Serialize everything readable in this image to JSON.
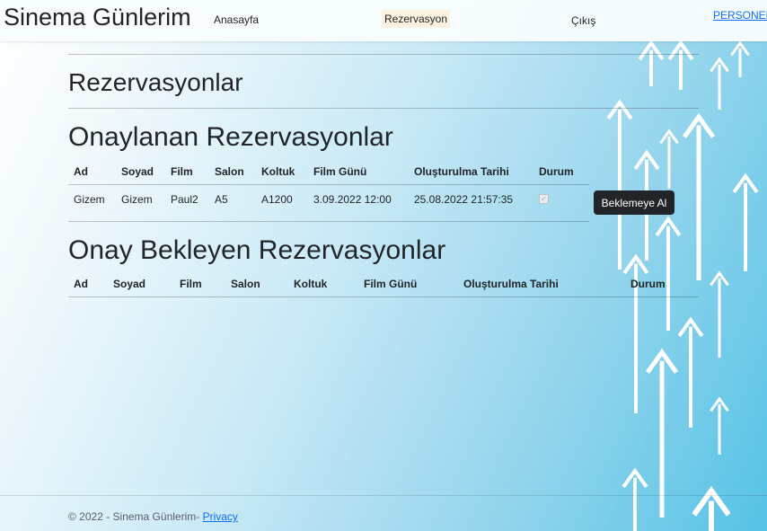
{
  "navbar": {
    "brand": "Sinema Günlerim",
    "links": {
      "home": "Anasayfa",
      "reservations": "Rezervasyon",
      "logout": "Çıkış"
    },
    "user": "PERSONEL"
  },
  "page": {
    "title": "Rezervasyonlar"
  },
  "approved": {
    "title": "Onaylanan Rezervasyonlar",
    "columns": [
      "Ad",
      "Soyad",
      "Film",
      "Salon",
      "Koltuk",
      "Film Günü",
      "Oluşturulma Tarihi",
      "Durum"
    ],
    "rows": [
      {
        "ad": "Gizem",
        "soyad": "Gizem",
        "film": "Paul2",
        "salon": "A5",
        "koltuk": "A1200",
        "film_gunu": "3.09.2022 12:00",
        "olusturulma": "25.08.2022 21:57:35",
        "durum_checked": true,
        "action_label": "Beklemeye Al"
      }
    ]
  },
  "pending": {
    "title": "Onay Bekleyen Rezervasyonlar",
    "columns": [
      "Ad",
      "Soyad",
      "Film",
      "Salon",
      "Koltuk",
      "Film Günü",
      "Oluşturulma Tarihi",
      "Durum"
    ],
    "rows": []
  },
  "footer": {
    "text": "© 2022 - Sinema Günlerim- ",
    "link": "Privacy"
  },
  "colors": {
    "bg_accent": "#56c3e6",
    "link": "#0d6efd",
    "button": "#212529",
    "active_nav_bg": "#fdf1df"
  }
}
